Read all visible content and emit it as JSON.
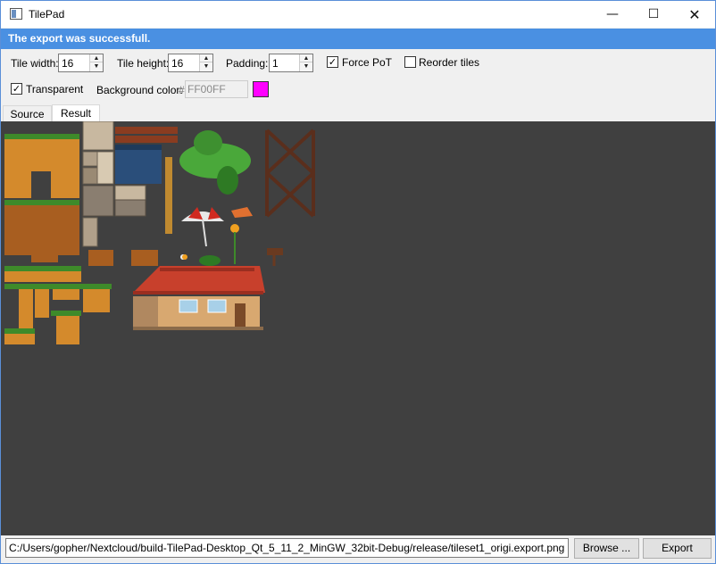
{
  "window": {
    "title": "TilePad",
    "minimize_glyph": "—",
    "maximize_glyph": "☐",
    "close_glyph": "✕"
  },
  "banner": {
    "text": "The export was successfull.",
    "color": "#4a90e2"
  },
  "options": {
    "tile_width_label": "Tile width:",
    "tile_width_value": "16",
    "tile_height_label": "Tile height:",
    "tile_height_value": "16",
    "padding_label": "Padding:",
    "padding_value": "1",
    "force_pot_label": "Force PoT",
    "force_pot_checked": true,
    "reorder_label": "Reorder tiles",
    "reorder_checked": false,
    "transparent_label": "Transparent",
    "transparent_checked": true,
    "bg_color_label": "Background color:",
    "bg_color_hash": "#",
    "bg_color_value": "FF00FF",
    "bg_color_swatch": "#ff00ff"
  },
  "tabs": {
    "source": "Source",
    "result": "Result",
    "active": "result"
  },
  "canvas": {
    "background": "#404040"
  },
  "footer": {
    "path": "C:/Users/gopher/Nextcloud/build-TilePad-Desktop_Qt_5_11_2_MinGW_32bit-Debug/release/tileset1_origi.export.png",
    "browse_label": "Browse ...",
    "export_label": "Export"
  },
  "icons": {
    "check": "✓",
    "spin_up": "▲",
    "spin_down": "▼"
  }
}
